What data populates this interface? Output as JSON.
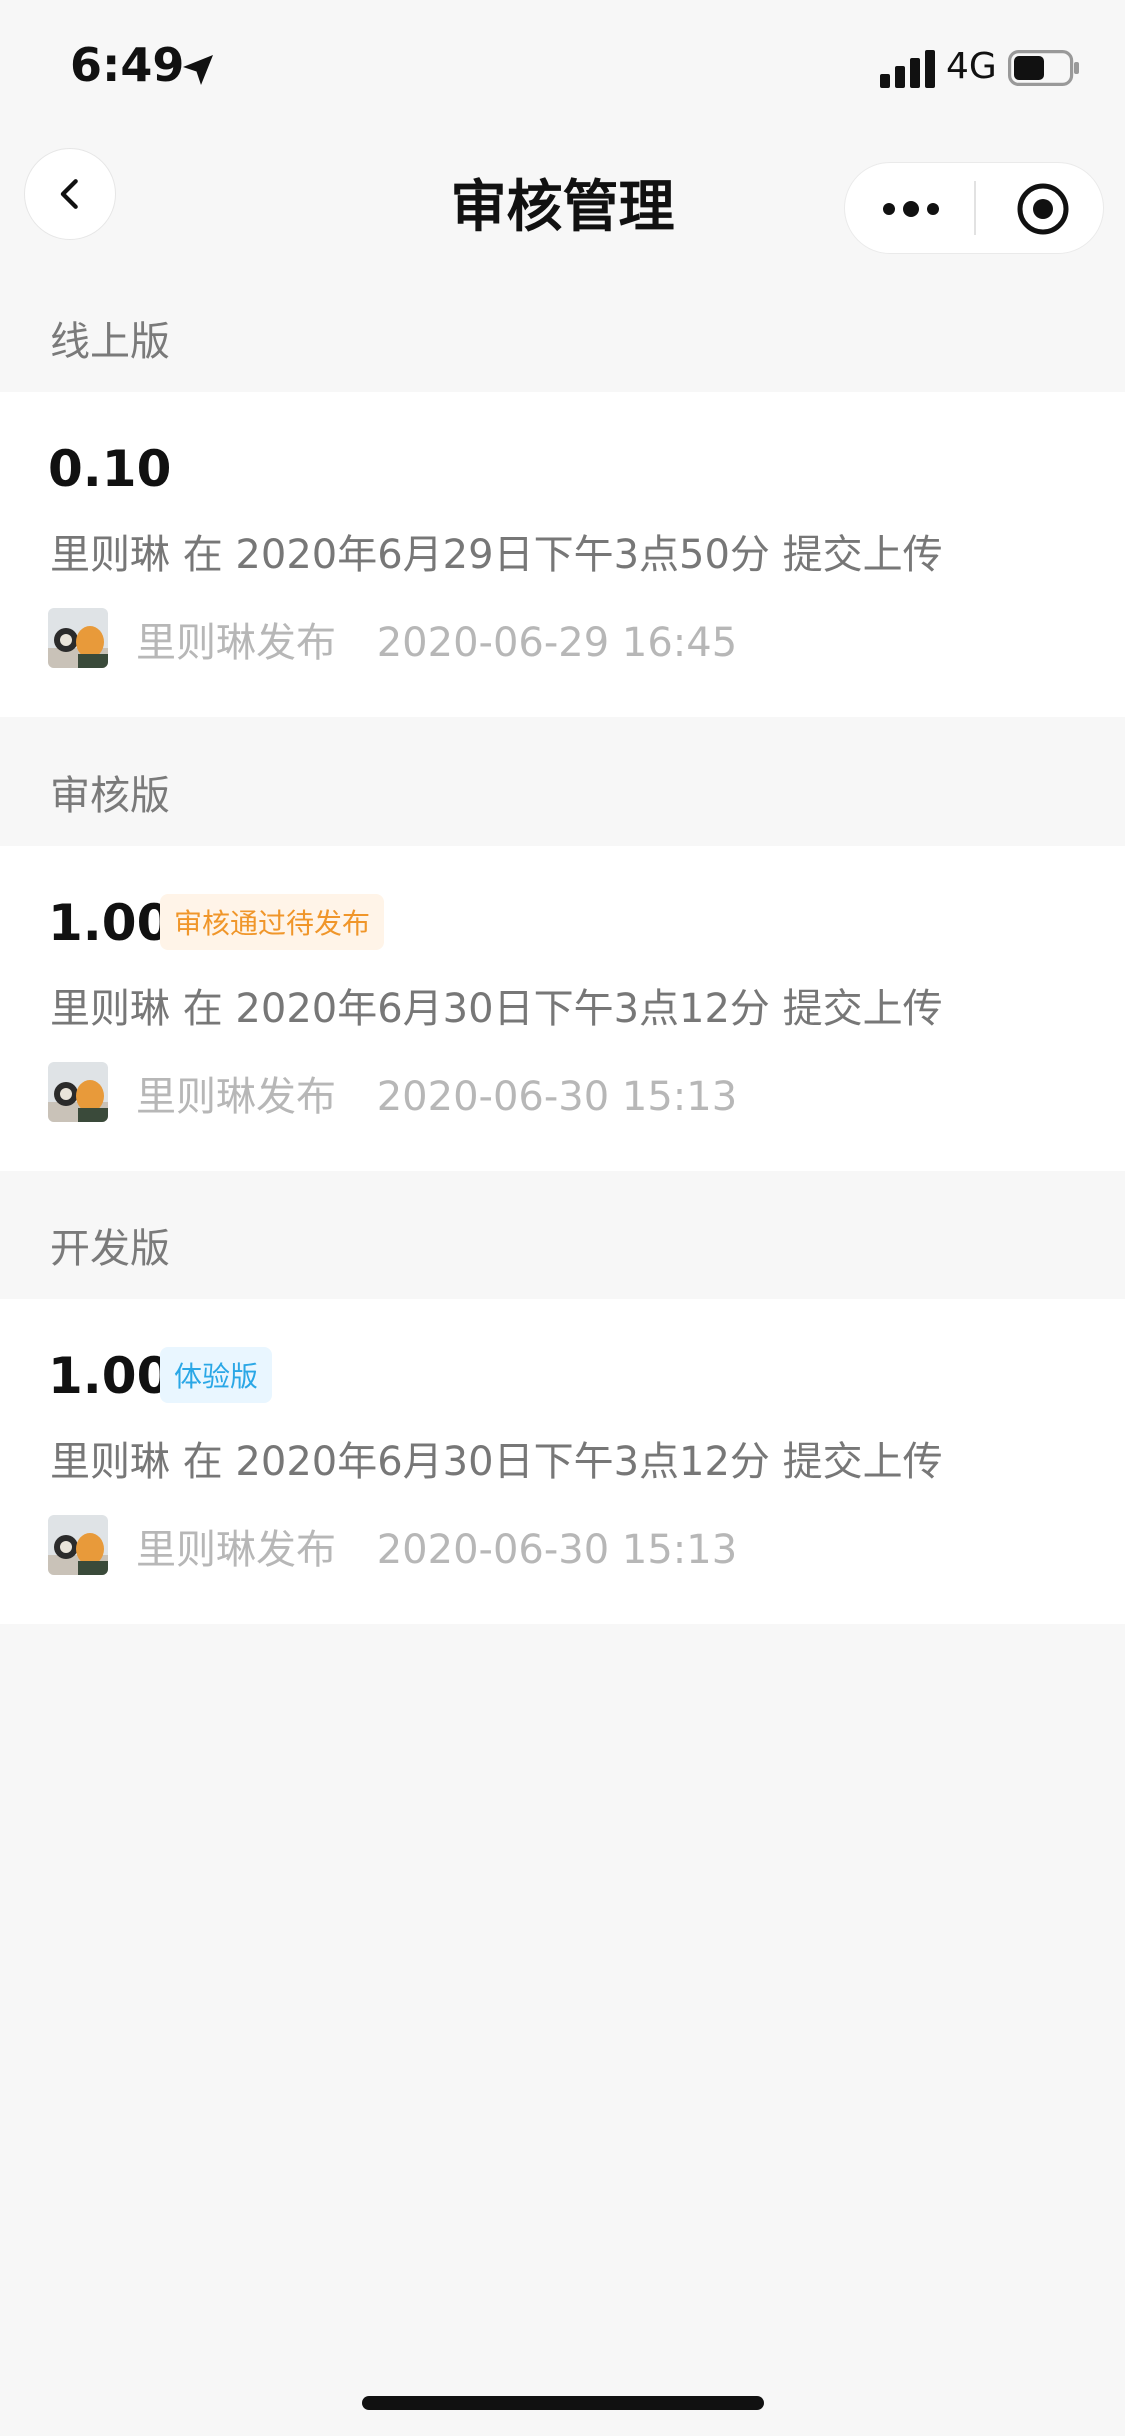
{
  "status": {
    "time": "6:49",
    "network": "4G"
  },
  "nav": {
    "title": "审核管理"
  },
  "sections": [
    {
      "header": "线上版",
      "item": {
        "version": "0.10",
        "badge": "",
        "description": "里则琳 在 2020年6月29日下午3点50分 提交上传",
        "publisher": "里则琳发布",
        "datetime": "2020-06-29 16:45"
      }
    },
    {
      "header": "审核版",
      "item": {
        "version": "1.00",
        "badge": "审核通过待发布",
        "description": "里则琳 在 2020年6月30日下午3点12分 提交上传",
        "publisher": "里则琳发布",
        "datetime": "2020-06-30 15:13"
      }
    },
    {
      "header": "开发版",
      "item": {
        "version": "1.00",
        "badge": "体验版",
        "description": "里则琳 在 2020年6月30日下午3点12分 提交上传",
        "publisher": "里则琳发布",
        "datetime": "2020-06-30 15:13"
      }
    }
  ],
  "colors": {
    "badge_review": "#f0962a",
    "badge_trial": "#2aa7e6",
    "background": "#f7f7f7"
  },
  "icons": [
    "location-arrow-icon",
    "signal-icon",
    "battery-icon",
    "back-chevron-icon",
    "more-dots-icon",
    "target-icon"
  ]
}
